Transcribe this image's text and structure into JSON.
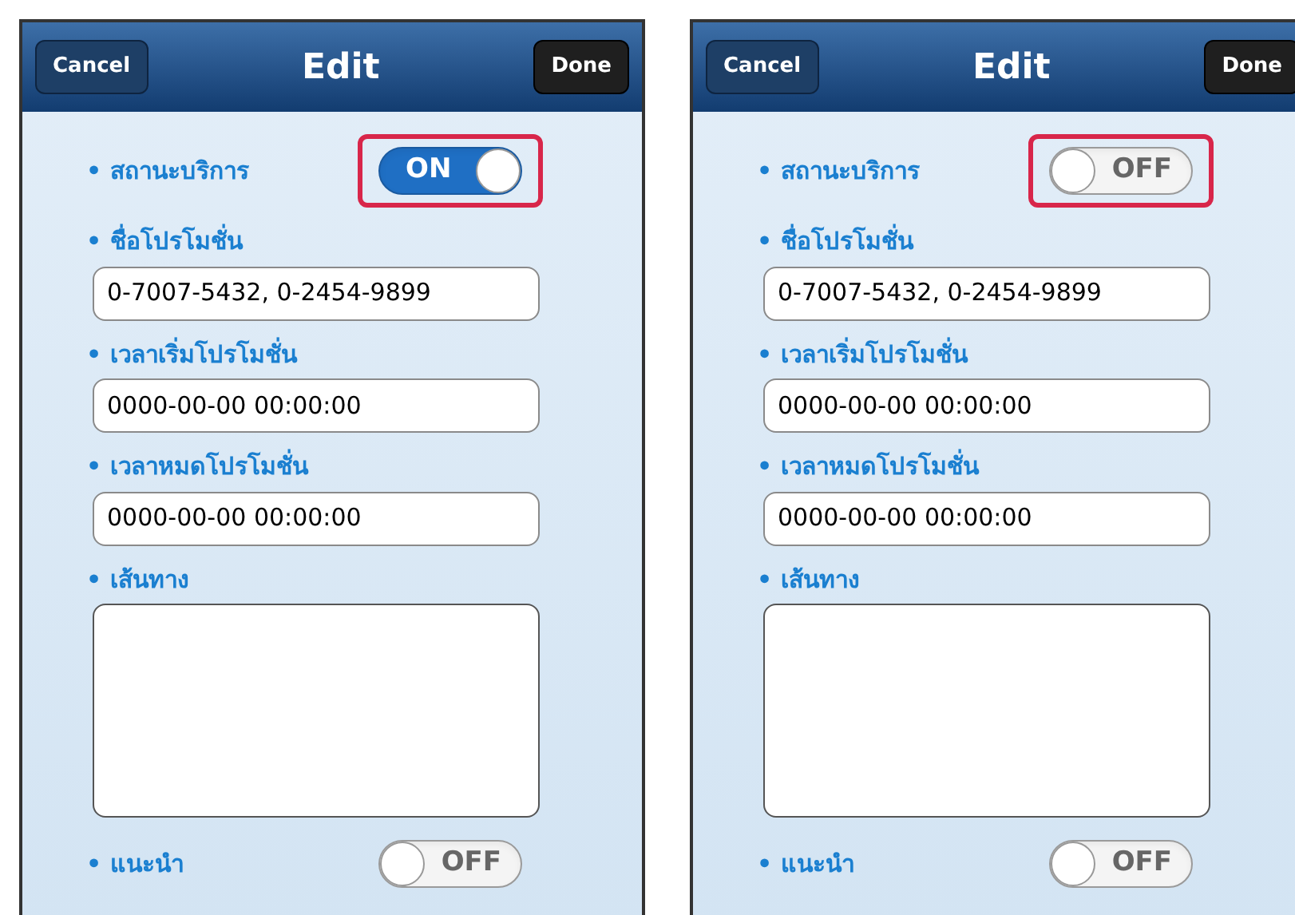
{
  "screens": [
    {
      "title": "Edit",
      "left_button": "Cancel",
      "right_button": "Done",
      "fields": [
        {
          "kind": "toggle",
          "label": "• สถานะบริการ",
          "on": true,
          "state_label": "ON",
          "highlighted": true
        },
        {
          "kind": "text",
          "label": "• ชื่อโปรโมชั่น",
          "value": "0-7007-5432, 0-2454-9899"
        },
        {
          "kind": "text",
          "label": "• เวลาเริ่มโปรโมชั่น",
          "value": "0000-00-00 00:00:00"
        },
        {
          "kind": "text",
          "label": "• เวลาหมดโปรโมชั่น",
          "value": "0000-00-00 00:00:00"
        },
        {
          "kind": "textarea",
          "label": "• เส้นทาง"
        },
        {
          "kind": "toggle",
          "label": "• แนะนำ",
          "on": false,
          "state_label": "OFF",
          "highlighted": false
        }
      ]
    },
    {
      "title": "Edit",
      "left_button": "Cancel",
      "right_button": "Done",
      "fields": [
        {
          "kind": "toggle",
          "label": "• สถานะบริการ",
          "on": false,
          "state_label": "OFF",
          "highlighted": true
        },
        {
          "kind": "text",
          "label": "• ชื่อโปรโมชั่น",
          "value": "0-7007-5432, 0-2454-9899"
        },
        {
          "kind": "text",
          "label": "• เวลาเริ่มโปรโมชั่น",
          "value": "0000-00-00 00:00:00"
        },
        {
          "kind": "text",
          "label": "• เวลาหมดโปรโมชั่น",
          "value": "0000-00-00 00:00:00"
        },
        {
          "kind": "textarea",
          "label": "• เส้นทาง"
        },
        {
          "kind": "toggle",
          "label": "• แนะนำ",
          "on": false,
          "state_label": "OFF",
          "highlighted": false
        }
      ]
    }
  ]
}
